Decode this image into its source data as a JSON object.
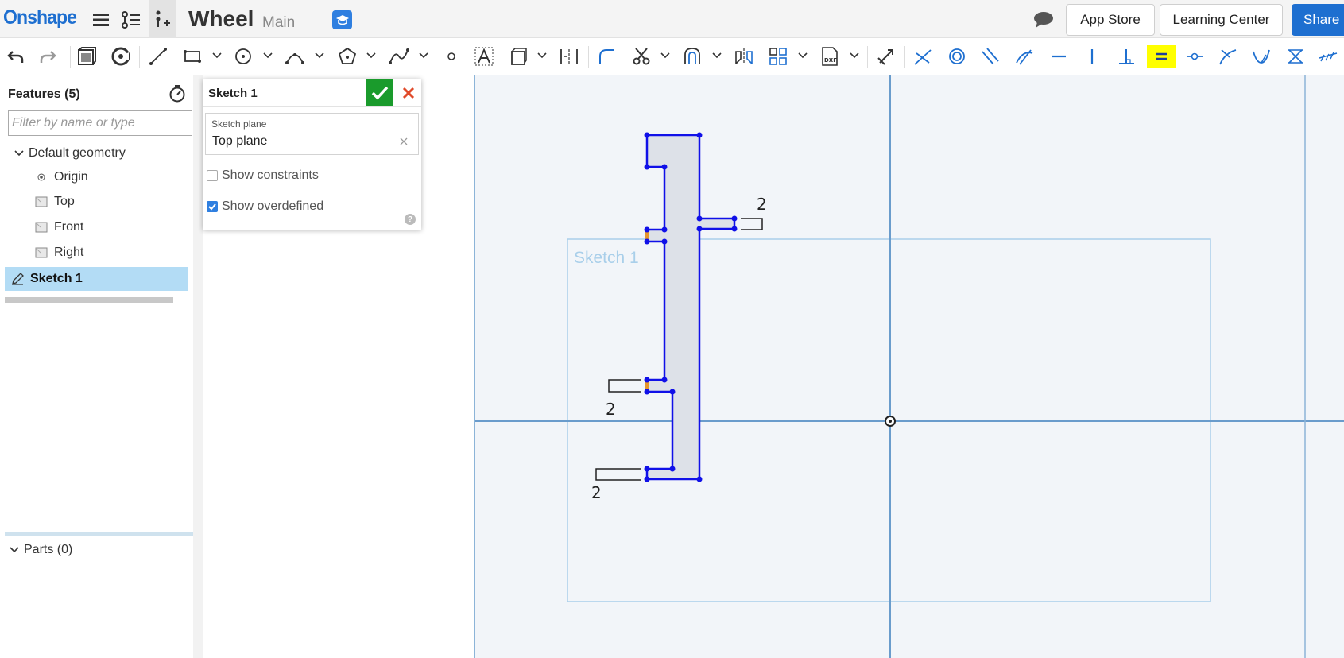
{
  "app": {
    "logo": "Onshape",
    "document_title": "Wheel",
    "workspace": "Main"
  },
  "header": {
    "app_store": "App Store",
    "learning_center": "Learning Center",
    "share": "Share"
  },
  "features": {
    "title": "Features (5)",
    "filter_placeholder": "Filter by name or type",
    "items": [
      {
        "label": "Default geometry",
        "icon": "chevron-down-icon"
      },
      {
        "label": "Origin",
        "icon": "origin-icon"
      },
      {
        "label": "Top",
        "icon": "plane-icon"
      },
      {
        "label": "Front",
        "icon": "plane-icon"
      },
      {
        "label": "Right",
        "icon": "plane-icon"
      },
      {
        "label": "Sketch 1",
        "icon": "sketch-icon",
        "selected": true
      }
    ],
    "parts": "Parts (0)"
  },
  "dialog": {
    "title": "Sketch 1",
    "plane_label": "Sketch plane",
    "plane_value": "Top plane",
    "show_constraints": "Show constraints",
    "show_constraints_checked": false,
    "show_overdefined": "Show overdefined",
    "show_overdefined_checked": true
  },
  "viewport": {
    "sketch_label": "Sketch 1",
    "dimensions": [
      "2",
      "2",
      "2"
    ],
    "colors": {
      "sketch_line": "#1010e8",
      "profile_fill": "#dde1e8",
      "plane_outline": "#a9cfea",
      "axis": "#6a9ccc",
      "highlight": "#e8962a"
    }
  },
  "toolbar": {
    "highlighted_tool": "equal-constraint"
  }
}
